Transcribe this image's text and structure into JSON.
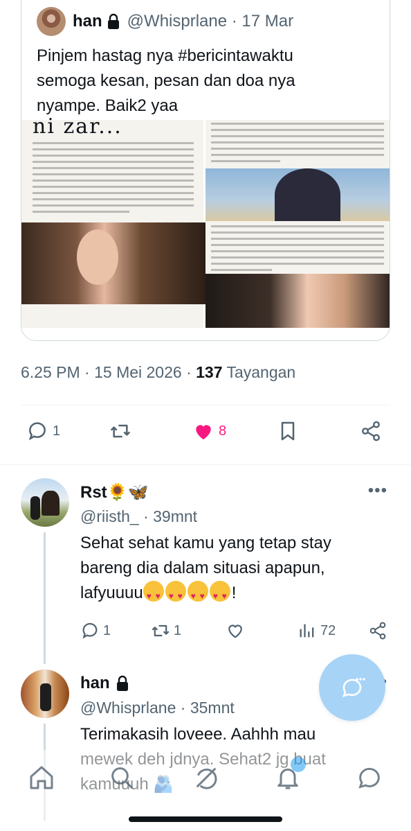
{
  "quoted_tweet": {
    "name": "han",
    "handle_date": "@Whisprlane · 17 Mar",
    "text": "Pinjem hastag nya #bericintawaktu\nsemoga kesan, pesan dan doa nya\nnyampe. Baik2 yaa",
    "media": {
      "title_fragment": "ni zar...",
      "left_paragraph": "tau gak? Banyak orang yang hidupnya mungkin lagi gak baik-baik aja. Karena pekerjaan, keluarga dan mungkin masalah lain. Tapi mereka bisa tersenyum dan semangat karena kamu hadir berkarya. Dampaknya memang sekuat itu tanpa kamu sadari. Tapi kami mungkin sering lupa. Kalo kamu juga manusia biasa yang mempunya banyak cerita di balik layar. Yang tidak terlihat, tidak sepenuhnya kami pahami. Maaf ya, kami kadang terlalu menekan bahumu kuat buat kami bersandar. Menuntutmu lebih banyak tanpa melihat, mengecam dan menyalahkanmu tanpa mencoba mengerti sudut pandangmu.",
      "right_paragraph_top": "banget bisa lalu ini dengan senyum tanpa menyalahkan siapapun atau bersembunyi\". Dari banyak-nya dinamika hidup kamu sebagai orang yang dikenal luas masyarakat. Semoga Allah ringankan bebanmu, melindungimu dan menjagamu.",
      "right_paragraph_bottom": "mendoakan sehingga jalanmu berkarya bisa kamu lalui dengan senyum. Istirahat yang banyak ya. I hope life treats you kindly and that you always find reasons to smile. Wishing you happiness, peace, and success in everything you do."
    }
  },
  "tweet_meta": {
    "time_date": "6.25 PM · 15 Mei 2026 · ",
    "views_count": "137",
    "views_label": " Tayangan"
  },
  "actions": {
    "reply_count": "1",
    "retweet_count": "",
    "like_count": "8",
    "colors": {
      "like": "#f91880",
      "icon": "#536471"
    }
  },
  "replies": [
    {
      "name": "Rst🌻🦋",
      "handle_time": "@riisth_ · 39mnt",
      "text_before_emoji": "Sehat sehat kamu yang tetap stay\nbareng dia dalam situasi apapun,\nlafyuuuu",
      "text_after_emoji": "!",
      "more": "•••",
      "reply_count": "1",
      "retweet_count": "1",
      "views_count": "72"
    },
    {
      "name": "han",
      "handle_time": "@Whisprlane · 35mnt",
      "text": "Terimakasih loveee. Aahhh mau\nmewek deh jdnya. Sehat2 jg buat\nkamuuuh 🫂",
      "more": "•••"
    }
  ],
  "fab": {
    "icon": "reply-bubble-icon",
    "color": "#a7d3f7"
  },
  "bottom_nav": [
    "home-icon",
    "search-icon",
    "grok-icon",
    "notifications-icon",
    "messages-icon"
  ]
}
